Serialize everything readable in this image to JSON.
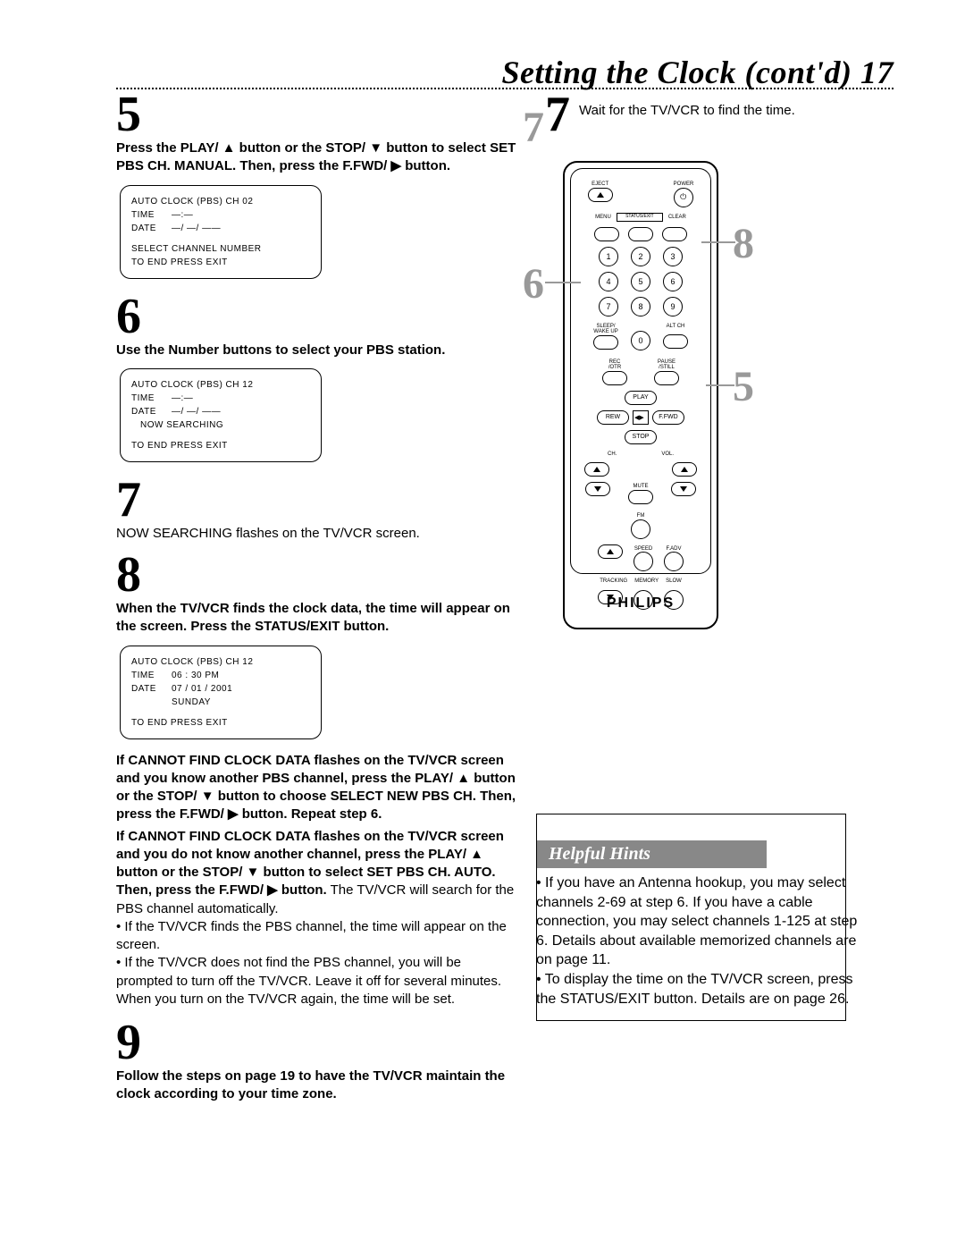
{
  "title": "Setting the Clock (cont'd)  17",
  "step5": {
    "num": "5",
    "text": "Press the PLAY/ ▲ button or the STOP/ ▼ button to select SET PBS CH. MANUAL. Then, press the F.FWD/ ▶ button."
  },
  "osd1": {
    "header": "AUTO CLOCK (PBS) CH 02",
    "time_label": "TIME",
    "time_val": "—:—",
    "date_label": "DATE",
    "date_val": "—/ —/ ——",
    "ln1": "SELECT CHANNEL NUMBER",
    "ln2": "TO END PRESS EXIT"
  },
  "step6": {
    "num": "6",
    "text": "Use the Number buttons to select your PBS station."
  },
  "osd2": {
    "header": "AUTO CLOCK (PBS) CH 12",
    "time_label": "TIME",
    "time_val": "—:—",
    "date_label": "DATE",
    "date_val": "—/ —/ ——",
    "now": "NOW SEARCHING",
    "end": "TO END PRESS EXIT"
  },
  "step7": {
    "num": "7",
    "text": "NOW SEARCHING flashes on the TV/VCR screen."
  },
  "step8": {
    "num": "8",
    "text": "When the TV/VCR finds the clock data, the time will appear on the screen. Press the STATUS/EXIT button."
  },
  "osd3": {
    "header": "AUTO CLOCK (PBS) CH 12",
    "time_label": "TIME",
    "time_val": "06 : 30 PM",
    "date_label": "DATE",
    "date_val": "07 / 01 / 2001",
    "day": "SUNDAY",
    "end": "TO END PRESS EXIT"
  },
  "cannot1": "If CANNOT FIND CLOCK DATA flashes on the TV/VCR screen and you know another PBS channel, press the PLAY/ ▲ button or the STOP/ ▼ button to choose SELECT NEW PBS CH. Then, press the F.FWD/ ▶ button. Repeat step 6.",
  "cannot2a": "If CANNOT FIND CLOCK DATA flashes on the TV/VCR screen and you do not know another channel, press the PLAY/ ▲ button or the STOP/ ▼ button to select SET PBS CH. AUTO",
  "cannot2b": ". Then, press the F.FWD/ ▶ button.",
  "cannot2c": " The TV/VCR will search for the PBS channel automatically.",
  "bullet1": "• If the TV/VCR finds the PBS channel, the time will appear on the screen.",
  "bullet2": "• If the TV/VCR does not find the PBS channel, you will be prompted to turn off the TV/VCR. Leave it off for several minutes. When you turn on the TV/VCR again, the time will be set.",
  "step9": {
    "num": "9",
    "text": "Follow the steps on page 19 to have the TV/VCR maintain the clock according to your time zone."
  },
  "step7r": {
    "num": "7",
    "text": "Wait for the TV/VCR to find the time."
  },
  "callouts": {
    "c5": "5",
    "c6": "6",
    "c7": "7",
    "c8": "8"
  },
  "remote": {
    "brand": "PHILIPS",
    "eject": "EJECT",
    "power": "POWER",
    "menu": "MENU",
    "status": "STATUS/EXIT",
    "clear": "CLEAR",
    "n1": "1",
    "n2": "2",
    "n3": "3",
    "n4": "4",
    "n5": "5",
    "n6": "6",
    "n7": "7",
    "n8": "8",
    "n9": "9",
    "n0": "0",
    "sleep": "SLEEP/\nWAKE UP",
    "altch": "ALT CH",
    "rec": "REC\n/OTR",
    "pause": "PAUSE\n/STILL",
    "play": "PLAY",
    "rew": "REW",
    "ffwd": "F.FWD",
    "stop": "STOP",
    "ch": "CH.",
    "vol": "VOL.",
    "mute": "MUTE",
    "fm": "FM",
    "speed": "SPEED",
    "fadv": "F.ADV",
    "tracking": "TRACKING",
    "memory": "MEMORY",
    "slow": "SLOW"
  },
  "hints": {
    "title": "Helpful Hints",
    "b1": "•  If you have an Antenna hookup, you may select channels 2-69 at step 6. If you have a cable connection, you may select channels 1-125 at step 6. Details about available memorized channels are on page 11.",
    "b2": "•  To display the time on the TV/VCR screen, press the STATUS/EXIT button. Details are on page 26."
  }
}
